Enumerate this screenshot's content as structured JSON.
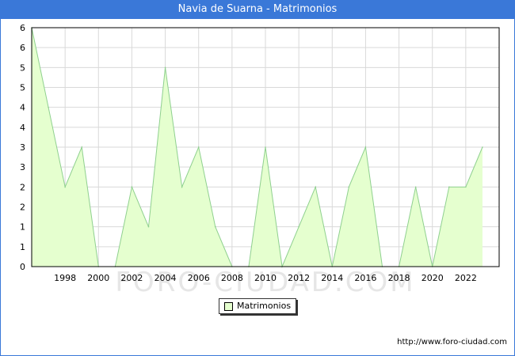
{
  "window": {
    "title": "Navia de Suarna - Matrimonios"
  },
  "chart_data": {
    "type": "area",
    "title": "Navia de Suarna - Matrimonios",
    "xlabel": "",
    "ylabel": "",
    "x": [
      1996,
      1997,
      1998,
      1999,
      2000,
      2001,
      2002,
      2003,
      2004,
      2005,
      2006,
      2007,
      2008,
      2009,
      2010,
      2011,
      2012,
      2013,
      2014,
      2015,
      2016,
      2017,
      2018,
      2019,
      2020,
      2021,
      2022,
      2023
    ],
    "series": [
      {
        "name": "Matrimonios",
        "values": [
          6,
          4,
          2,
          3,
          0,
          0,
          2,
          1,
          5,
          2,
          3,
          1,
          0,
          0,
          3,
          0,
          1,
          2,
          0,
          2,
          3,
          0,
          0,
          2,
          0,
          2,
          2,
          3
        ]
      }
    ],
    "xlim": [
      1996,
      2024
    ],
    "ylim": [
      0,
      6
    ],
    "x_tick_labels": [
      "1998",
      "2000",
      "2002",
      "2004",
      "2006",
      "2008",
      "2010",
      "2012",
      "2014",
      "2016",
      "2018",
      "2020",
      "2022"
    ],
    "y_tick_labels": [
      "0",
      "1",
      "1",
      "2",
      "2",
      "3",
      "3",
      "4",
      "4",
      "5",
      "5",
      "6",
      "6"
    ],
    "grid": true,
    "legend_position": "bottom-center",
    "colors": {
      "fill": "#e5ffcf",
      "line": "#8fd08f",
      "grid": "#d9d9d9",
      "header": "#3a78d8"
    }
  },
  "legend": {
    "label": "Matrimonios"
  },
  "watermark": "FORO-CIUDAD.COM",
  "footer": {
    "source_url": "http://www.foro-ciudad.com"
  }
}
